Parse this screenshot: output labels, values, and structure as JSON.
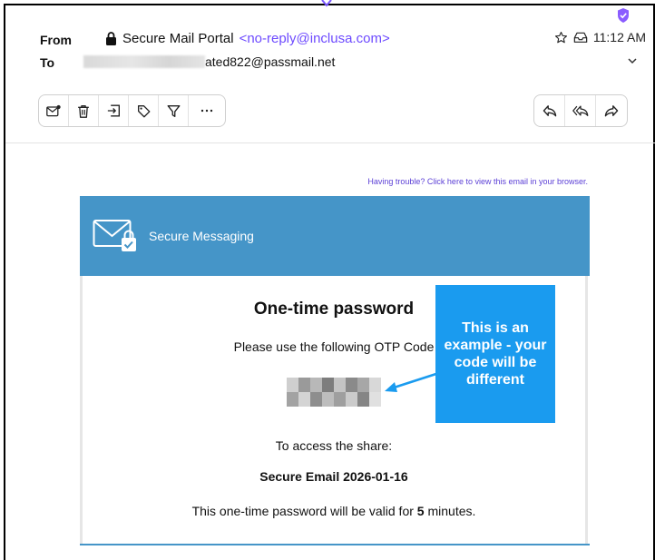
{
  "header": {
    "from_label": "From",
    "to_label": "To",
    "sender_name": "Secure Mail Portal",
    "sender_email": "<no-reply@inclusa.com>",
    "recipient_visible": "ated822@passmail.net",
    "time": "11:12 AM"
  },
  "email": {
    "trouble_link": "Having trouble? Click here to view this email in your browser.",
    "banner_title": "Secure Messaging",
    "otp_title": "One-time password",
    "otp_instruction": "Please use the following OTP Code",
    "access_text": "To access the share:",
    "share_name": "Secure Email 2026-01-16",
    "valid_prefix": "This one-time password will be valid for ",
    "valid_minutes": "5",
    "valid_suffix": " minutes."
  },
  "annotation": {
    "callout_text": "This is an example - your code will be different"
  },
  "colors": {
    "accent": "#6d4aff",
    "banner": "#4595c8",
    "callout": "#1a9bef"
  }
}
